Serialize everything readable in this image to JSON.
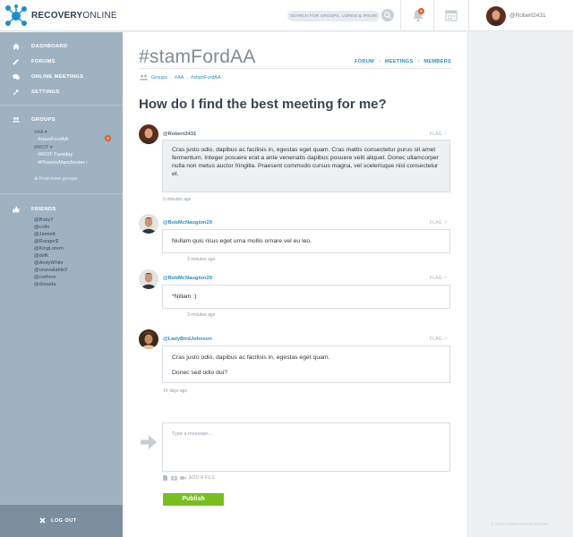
{
  "brand": {
    "name_bold": "RECOVERY",
    "name_light": "ONLINE"
  },
  "search": {
    "placeholder": "SEARCH FOR GROUPS, LOREM & IPSUM"
  },
  "notifications": {
    "count": "6"
  },
  "user": {
    "name": "@Robert2431"
  },
  "sidebar": {
    "nav": [
      {
        "label": "DASHBOARD",
        "icon": "home-icon"
      },
      {
        "label": "FORUMS",
        "icon": "pencil-icon"
      },
      {
        "label": "ONLINE MEETINGS",
        "icon": "chat-icon"
      },
      {
        "label": "SETTINGS",
        "icon": "wrench-icon"
      }
    ],
    "groups_label": "GROUPS",
    "groups": [
      "#AA ▾",
      "#stamFordAA",
      "#RIOT ▾",
      "#RIOT-Tuesday",
      "#PhoenixManchester ‹"
    ],
    "group_badge": "2",
    "find_more": "Find more groups",
    "friends_label": "FRIENDS",
    "friends": [
      "@BobyT",
      "@colin",
      "@JamieK",
      "@Ranger$",
      "@KingLorem",
      "@dsfk",
      "@AndyWhite",
      "@unavailable3",
      "@nothere",
      "@donada"
    ],
    "logout": "LOG OUT"
  },
  "page": {
    "title": "#stamFordAA",
    "tabs": [
      "FORUM",
      "MEETINGS",
      "MEMBERS"
    ],
    "breadcrumb": [
      "Groups",
      "#AA",
      "#stamFordAA"
    ],
    "question": "How do I find the best meeting for me?"
  },
  "flag_label": "FLAG",
  "posts": [
    {
      "user": "@Robert2431",
      "paragraphs": [
        "Cras justo odio, dapibus ac facilisis in, egestas eget quam. Cras mattis consectetur purus sit amet fermentum. Integer posuere erat a ante venenatis dapibus posuere velit aliquet. Donec ullamcorper nulla non metus auctor fringilla. Praesent commodo cursus magna, vel scelerisque nisl consectetur et."
      ],
      "time": "5 minutes ago"
    },
    {
      "user": "@BobMcNaugton29",
      "paragraphs": [
        "Nullam quis risus eget urna mollis ornare vel eu leo."
      ],
      "time": "3 minutes ago"
    },
    {
      "user": "@BobMcNaugton29",
      "paragraphs": [
        "*Nillam :)"
      ],
      "time": "3 minutes ago"
    },
    {
      "user": "@LadyBirdJohnson",
      "paragraphs": [
        "Cras justo odio, dapibus ac facilisis in, egestas eget quam.",
        "Donec sed odio dui?"
      ],
      "time": "14 days ago"
    }
  ],
  "compose": {
    "placeholder": "Type a message...",
    "attach_label": "ADD A FILE",
    "publish_label": "Publish"
  },
  "footer": {
    "copyright": "© 2013 LOREM IPSUM DOLOR"
  },
  "colors": {
    "accent": "#2a8fc4",
    "sidebar": "#9fb2c1",
    "publish": "#78be20",
    "badge": "#e05a26"
  }
}
